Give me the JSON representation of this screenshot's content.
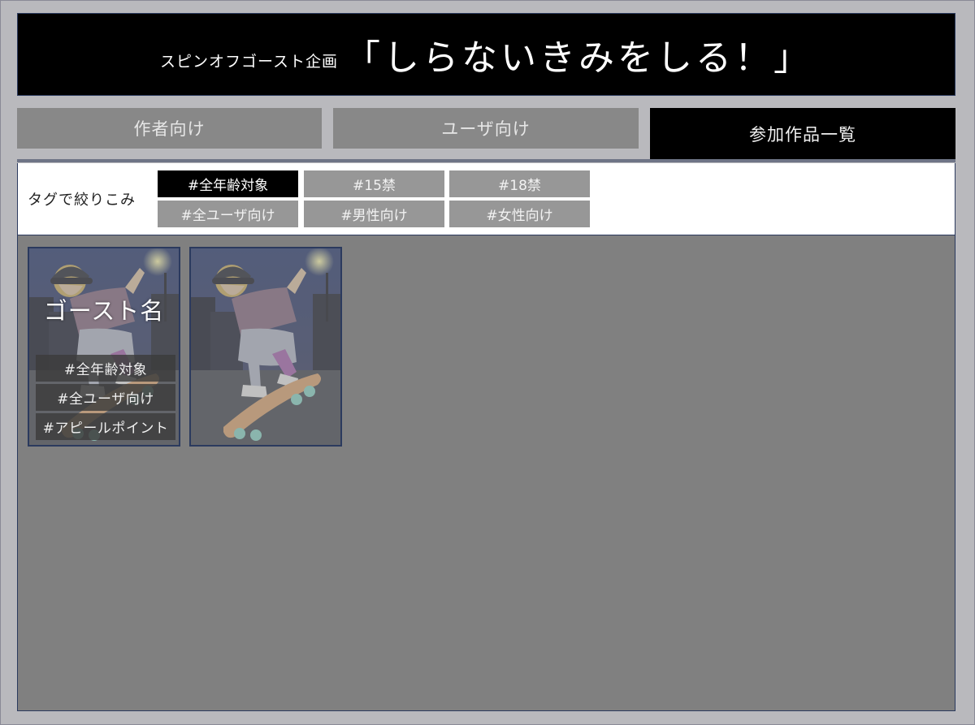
{
  "header": {
    "subtitle": "スピンオフゴースト企画",
    "title": "「しらないきみをしる！」"
  },
  "tabs": [
    {
      "label": "作者向け",
      "active": false
    },
    {
      "label": "ユーザ向け",
      "active": false
    },
    {
      "label": "参加作品一覧",
      "active": true
    }
  ],
  "filter": {
    "label": "タグで絞りこみ",
    "tags": [
      {
        "label": "#全年齢対象",
        "selected": true
      },
      {
        "label": "#15禁",
        "selected": false
      },
      {
        "label": "#18禁",
        "selected": false
      },
      {
        "label": "#全ユーザ向け",
        "selected": false
      },
      {
        "label": "#男性向け",
        "selected": false
      },
      {
        "label": "#女性向け",
        "selected": false
      }
    ]
  },
  "cards": [
    {
      "ghost_name": "ゴースト名",
      "tags": [
        "#全年齢対象",
        "#全ユーザ向け",
        "#アピールポイント"
      ],
      "hover": true
    },
    {
      "hover": false
    }
  ],
  "colors": {
    "page_bg": "#b9b9bd",
    "header_bg": "#000000",
    "tab_inactive": "#888888",
    "tab_active": "#000000",
    "tag_off": "#979797",
    "tag_on": "#000000",
    "content_bg": "#808080",
    "border": "#2b3a5e"
  }
}
